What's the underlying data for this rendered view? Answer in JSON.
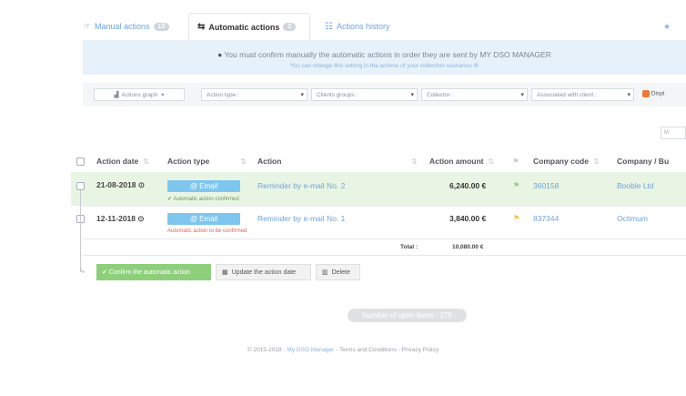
{
  "tabs": [
    {
      "icon": "hand-pointer-icon",
      "label": "Manual actions",
      "badge": "13"
    },
    {
      "icon": "retweet-icon",
      "label": "Automatic actions",
      "badge": "2"
    },
    {
      "icon": "list-icon",
      "label": "Actions history"
    }
  ],
  "banner": {
    "message": "You must confirm manually the automatic actions in order they are sent by MY DSO MANAGER",
    "sub": "You can change this setting in the actions of your collection scenarios"
  },
  "filters": {
    "graph_label": "Actions graph",
    "action_type": "Action type :",
    "clients_groups": "Clients groups :",
    "collector": "Collector :",
    "associated_client": "Associated with client :",
    "display": "Displ"
  },
  "search_box_text": "M",
  "table": {
    "headers": [
      "Action date",
      "Action type",
      "Action",
      "Action amount",
      "Company code",
      "Company / Bu"
    ],
    "rows": [
      {
        "date": "21-08-2018",
        "type": "@ Email",
        "action": "Reminder by e-mail No. 2",
        "amount": "6,240.00 €",
        "flag_color": "#8ecf7c",
        "company_code": "360158",
        "company": "Booble Ltd",
        "note": "✔ Automatic action confirmed",
        "note_color": "#6a9a5a"
      },
      {
        "date": "12-11-2018",
        "type": "@ Email",
        "action": "Reminder by e-mail No. 1",
        "amount": "3,840.00 €",
        "flag_color": "#f0c24a",
        "company_code": "837344",
        "company": "Octimum",
        "note": "Automatic action to be confirmed",
        "note_color": "#e0625f"
      }
    ],
    "total_label": "Total :",
    "total_value": "10,080.00 €"
  },
  "actions": {
    "confirm": "✔ Confirm the automatic action",
    "update": "Update the action date",
    "delete": "Delete"
  },
  "open_items": "Number of open items : 275",
  "footer": {
    "prefix": "© 2015-2018 - ",
    "brand": "My DSO Manager",
    "rest": " - Terms and Conditions - Privacy Policy"
  },
  "colors": {
    "accent": "#6fa3d8",
    "banner_bg": "#e6f1fa",
    "confirm_green": "#8ecf7c",
    "email_blue": "#7fc6ee"
  }
}
